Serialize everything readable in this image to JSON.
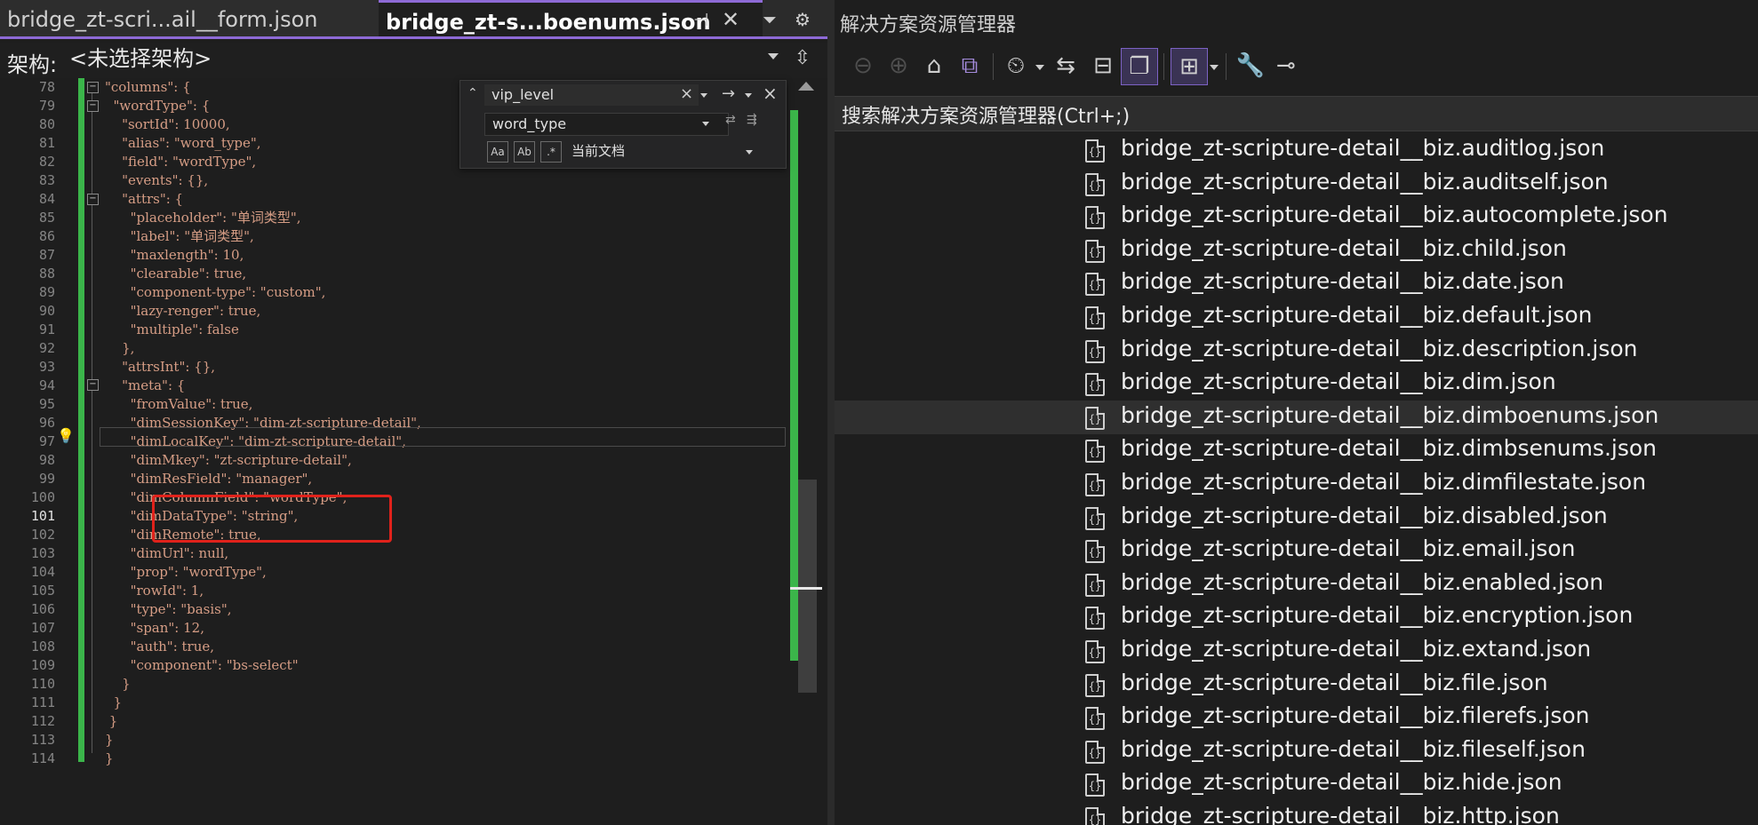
{
  "tabs": {
    "inactive_label": "bridge_zt-scri...ail__form.json",
    "active_label": "bridge_zt-s...boenums.json",
    "pin_glyph": "⊣",
    "close_glyph": "✕",
    "dropdown_glyph": "⏷",
    "settings_glyph": "⚙"
  },
  "schema": {
    "label": "架构:",
    "value": "<未选择架构>"
  },
  "editor": {
    "current_line": 101,
    "lines": [
      {
        "n": 78,
        "code": "\"columns\": {"
      },
      {
        "n": 79,
        "code": "  \"wordType\": {"
      },
      {
        "n": 80,
        "code": "    \"sortId\": 10000,"
      },
      {
        "n": 81,
        "code": "    \"alias\": \"word_type\","
      },
      {
        "n": 82,
        "code": "    \"field\": \"wordType\","
      },
      {
        "n": 83,
        "code": "    \"events\": {},"
      },
      {
        "n": 84,
        "code": "    \"attrs\": {"
      },
      {
        "n": 85,
        "code": "      \"placeholder\": \"单词类型\","
      },
      {
        "n": 86,
        "code": "      \"label\": \"单词类型\","
      },
      {
        "n": 87,
        "code": "      \"maxlength\": 10,"
      },
      {
        "n": 88,
        "code": "      \"clearable\": true,"
      },
      {
        "n": 89,
        "code": "      \"component-type\": \"custom\","
      },
      {
        "n": 90,
        "code": "      \"lazy-renger\": true,"
      },
      {
        "n": 91,
        "code": "      \"multiple\": false"
      },
      {
        "n": 92,
        "code": "    },"
      },
      {
        "n": 93,
        "code": "    \"attrsInt\": {},"
      },
      {
        "n": 94,
        "code": "    \"meta\": {"
      },
      {
        "n": 95,
        "code": "      \"fromValue\": true,"
      },
      {
        "n": 96,
        "code": "      \"dimSessionKey\": \"dim-zt-scripture-detail\","
      },
      {
        "n": 97,
        "code": "      \"dimLocalKey\": \"dim-zt-scripture-detail\","
      },
      {
        "n": 98,
        "code": "      \"dimMkey\": \"zt-scripture-detail\","
      },
      {
        "n": 99,
        "code": "      \"dimResField\": \"manager\","
      },
      {
        "n": 100,
        "code": "      \"dimColumnField\": \"wordType\","
      },
      {
        "n": 101,
        "code": "      \"dimDataType\": \"string\","
      },
      {
        "n": 102,
        "code": "      \"dimRemote\": true,"
      },
      {
        "n": 103,
        "code": "      \"dimUrl\": null,"
      },
      {
        "n": 104,
        "code": "      \"prop\": \"wordType\","
      },
      {
        "n": 105,
        "code": "      \"rowId\": 1,"
      },
      {
        "n": 106,
        "code": "      \"type\": \"basis\","
      },
      {
        "n": 107,
        "code": "      \"span\": 12,"
      },
      {
        "n": 108,
        "code": "      \"auth\": true,"
      },
      {
        "n": 109,
        "code": "      \"component\": \"bs-select\""
      },
      {
        "n": 110,
        "code": "    }"
      },
      {
        "n": 111,
        "code": "  }"
      },
      {
        "n": 112,
        "code": " }"
      },
      {
        "n": 113,
        "code": "}"
      },
      {
        "n": 114,
        "code": "}"
      }
    ]
  },
  "find": {
    "search_value": "vip_level",
    "replace_value": "word_type",
    "scope": "当前文档",
    "opt_case": "Aa",
    "opt_word": "Ab",
    "opt_regex": ".*"
  },
  "explorer": {
    "title": "解决方案资源管理器",
    "search_placeholder": "搜索解决方案资源管理器(Ctrl+;)",
    "file_icon_glyph": "{}",
    "selected_index": 8,
    "files": [
      "bridge_zt-scripture-detail__biz.auditlog.json",
      "bridge_zt-scripture-detail__biz.auditself.json",
      "bridge_zt-scripture-detail__biz.autocomplete.json",
      "bridge_zt-scripture-detail__biz.child.json",
      "bridge_zt-scripture-detail__biz.date.json",
      "bridge_zt-scripture-detail__biz.default.json",
      "bridge_zt-scripture-detail__biz.description.json",
      "bridge_zt-scripture-detail__biz.dim.json",
      "bridge_zt-scripture-detail__biz.dimboenums.json",
      "bridge_zt-scripture-detail__biz.dimbsenums.json",
      "bridge_zt-scripture-detail__biz.dimfilestate.json",
      "bridge_zt-scripture-detail__biz.disabled.json",
      "bridge_zt-scripture-detail__biz.email.json",
      "bridge_zt-scripture-detail__biz.enabled.json",
      "bridge_zt-scripture-detail__biz.encryption.json",
      "bridge_zt-scripture-detail__biz.extand.json",
      "bridge_zt-scripture-detail__biz.file.json",
      "bridge_zt-scripture-detail__biz.filerefs.json",
      "bridge_zt-scripture-detail__biz.fileself.json",
      "bridge_zt-scripture-detail__biz.hide.json",
      "bridge_zt-scripture-detail__biz.http.json"
    ]
  }
}
